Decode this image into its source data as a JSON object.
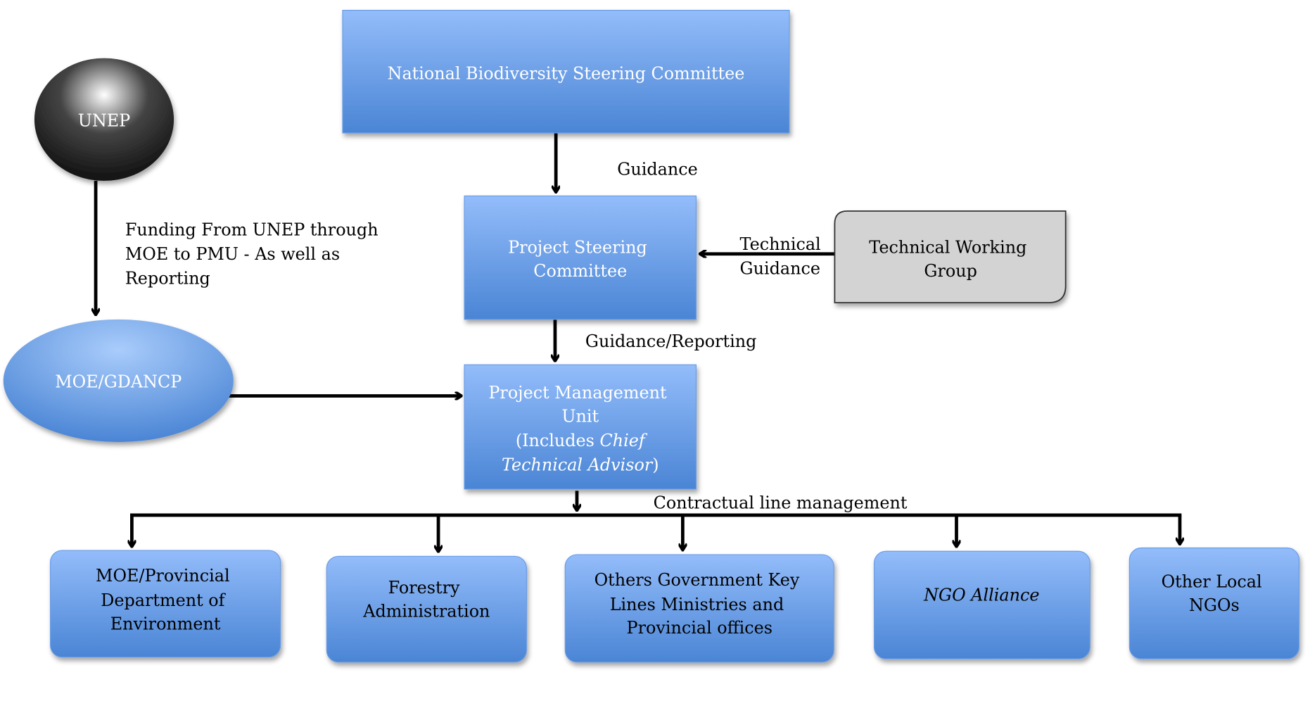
{
  "colors": {
    "box_top": "#93bcfa",
    "box_bottom": "#4a85d5",
    "unep": "#222222",
    "twg": "#d3d3d3"
  },
  "nodes": {
    "nbsc": "National Biodiversity Steering Committee",
    "unep": "UNEP",
    "psc": [
      "Project Steering",
      "Committee"
    ],
    "twg": [
      "Technical Working",
      "Group"
    ],
    "moe": "MOE/GDANCP",
    "pmu": {
      "l1": "Project Management",
      "l2": "Unit",
      "l3a": "(Includes ",
      "l3b": "Chief",
      "l4a": "Technical Advisor",
      "l4b": ")"
    },
    "bottom": [
      [
        "MOE/Provincial",
        "Department of",
        "Environment"
      ],
      [
        "Forestry",
        "Administration"
      ],
      [
        "Others Government Key",
        "Lines Ministries and",
        "Provincial offices"
      ],
      [
        "NGO Alliance"
      ],
      [
        "Other Local",
        "NGOs"
      ]
    ]
  },
  "labels": {
    "guidance": "Guidance",
    "funding": [
      "Funding From UNEP through",
      "MOE to PMU  - As well as",
      "Reporting"
    ],
    "technical_guidance": [
      "Technical",
      "Guidance"
    ],
    "guidance_reporting": "Guidance/Reporting",
    "contractual": "Contractual line management"
  }
}
